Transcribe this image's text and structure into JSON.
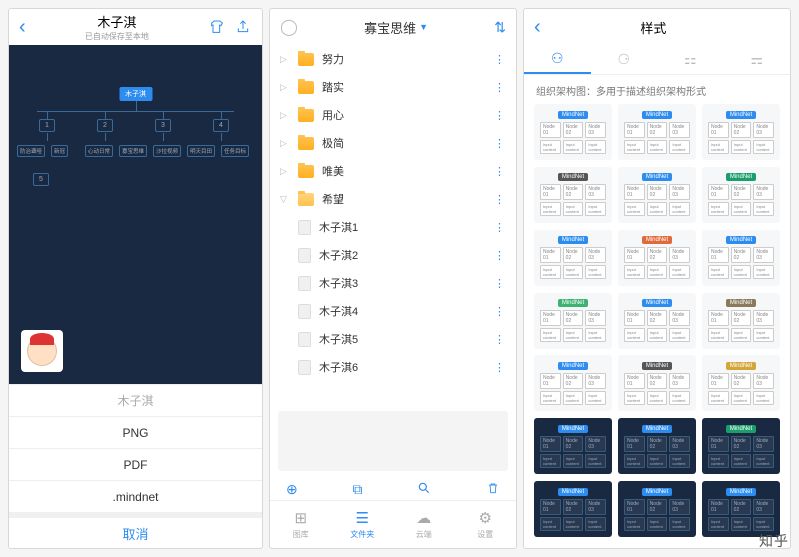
{
  "pane1": {
    "title": "木子淇",
    "subtitle": "已自动保存至本地",
    "mindmap": {
      "root": "木子淇",
      "row2": [
        "1",
        "2",
        "3",
        "4"
      ],
      "row3": [
        "防治聋哑",
        "新冠",
        "心动日常",
        "寡宝思维",
        "沙拉视频",
        "明天目田",
        "任务目标"
      ],
      "row4": "5"
    },
    "export_name": "木子淇",
    "formats": [
      "PNG",
      "PDF",
      ".mindnet"
    ],
    "cancel": "取消"
  },
  "pane2": {
    "title": "寡宝思维",
    "folders": [
      {
        "label": "努力",
        "open": false
      },
      {
        "label": "踏实",
        "open": false
      },
      {
        "label": "用心",
        "open": false
      },
      {
        "label": "极简",
        "open": false
      },
      {
        "label": "唯美",
        "open": false
      },
      {
        "label": "希望",
        "open": true
      }
    ],
    "files": [
      "木子淇1",
      "木子淇2",
      "木子淇3",
      "木子淇4",
      "木子淇5",
      "木子淇6"
    ],
    "topbar": {
      "add": "＋",
      "trash": "🗑"
    },
    "tabs": [
      {
        "label": "图库",
        "icon": "⊞"
      },
      {
        "label": "文件夹",
        "icon": "☰"
      },
      {
        "label": "云端",
        "icon": "☁"
      },
      {
        "label": "设置",
        "icon": "⚙"
      }
    ],
    "active_tab": 1
  },
  "pane3": {
    "title": "样式",
    "desc": "组织架构图：多用于描述组织架构形式",
    "thumb_root": "MindNet",
    "thumb_nodes": [
      "Node 01",
      "Node 02",
      "Node 03"
    ],
    "thumb_sub": "Input content",
    "roots": [
      {
        "c": "#2d8cf0",
        "d": false
      },
      {
        "c": "#2d8cf0",
        "d": false
      },
      {
        "c": "#2d8cf0",
        "d": false
      },
      {
        "c": "#555",
        "d": false
      },
      {
        "c": "#2d8cf0",
        "d": false
      },
      {
        "c": "#1a9e6b",
        "d": false
      },
      {
        "c": "#2d8cf0",
        "d": false
      },
      {
        "c": "#e06a3b",
        "d": false
      },
      {
        "c": "#2d8cf0",
        "d": false
      },
      {
        "c": "#3cb371",
        "d": false
      },
      {
        "c": "#2d8cf0",
        "d": false
      },
      {
        "c": "#8a7a5a",
        "d": false
      },
      {
        "c": "#2d8cf0",
        "d": false
      },
      {
        "c": "#555",
        "d": false
      },
      {
        "c": "#d4a63a",
        "d": false
      },
      {
        "c": "#2d8cf0",
        "d": true
      },
      {
        "c": "#2d8cf0",
        "d": true
      },
      {
        "c": "#1a9e6b",
        "d": true
      },
      {
        "c": "#2d8cf0",
        "d": true
      },
      {
        "c": "#2d8cf0",
        "d": true
      },
      {
        "c": "#2d8cf0",
        "d": true
      }
    ]
  },
  "watermark": "知乎"
}
